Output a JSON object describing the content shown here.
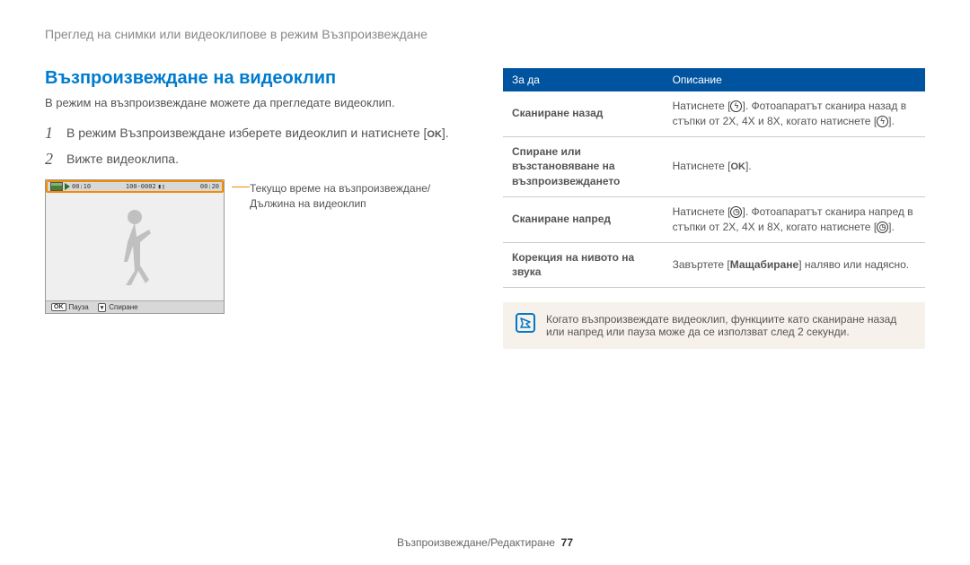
{
  "breadcrumb": "Преглед на снимки или видеоклипове в режим Възпроизвеждане",
  "section_title": "Възпроизвеждане на видеоклип",
  "intro": "В режим на възпроизвеждане можете да прегледате видеоклип.",
  "steps": [
    {
      "num": "1",
      "text_a": "В режим Възпроизвеждане изберете видеоклип и натиснете [",
      "text_b": "]."
    },
    {
      "num": "2",
      "text_a": "Вижте видеоклипа.",
      "text_b": ""
    }
  ],
  "ok_label": "OK",
  "player": {
    "time_current": "00:10",
    "time_total": "00:20",
    "counter": "100-0002",
    "bottom_pause": "Пауза",
    "bottom_stop": "Спиране",
    "icon_down": "▾"
  },
  "callout_line1": "Текущо време на възпроизвеждане/",
  "callout_line2": "Дължина на видеоклип",
  "table": {
    "head_action": "За да",
    "head_desc": "Описание",
    "rows": [
      {
        "action": "Сканиране назад",
        "desc_a": "Натиснете [",
        "icon": "flash",
        "desc_b": "]. Фотоапаратът сканира назад в стъпки от 2X, 4X и 8X, когато натиснете [",
        "desc_c": "]."
      },
      {
        "action": "Спиране или възстановяване на възпроизвеждането",
        "desc_a": "Натиснете [",
        "icon": "ok",
        "desc_b": "].",
        "desc_c": ""
      },
      {
        "action": "Сканиране напред",
        "desc_a": "Натиснете [",
        "icon": "timer",
        "desc_b": "]. Фотоапаратът сканира напред в стъпки от 2X, 4X и 8X, когато натиснете [",
        "desc_c": "]."
      },
      {
        "action": "Корекция на нивото на звука",
        "desc_a": "Завъртете [",
        "icon": "bold",
        "bold": "Мащабиране",
        "desc_b": "] наляво или надясно.",
        "desc_c": ""
      }
    ]
  },
  "note": "Когато възпроизвеждате видеоклип, функциите като сканиране назад или напред или пауза може да се използват след 2 секунди.",
  "footer_text": "Възпроизвеждане/Редактиране",
  "footer_page": "77"
}
